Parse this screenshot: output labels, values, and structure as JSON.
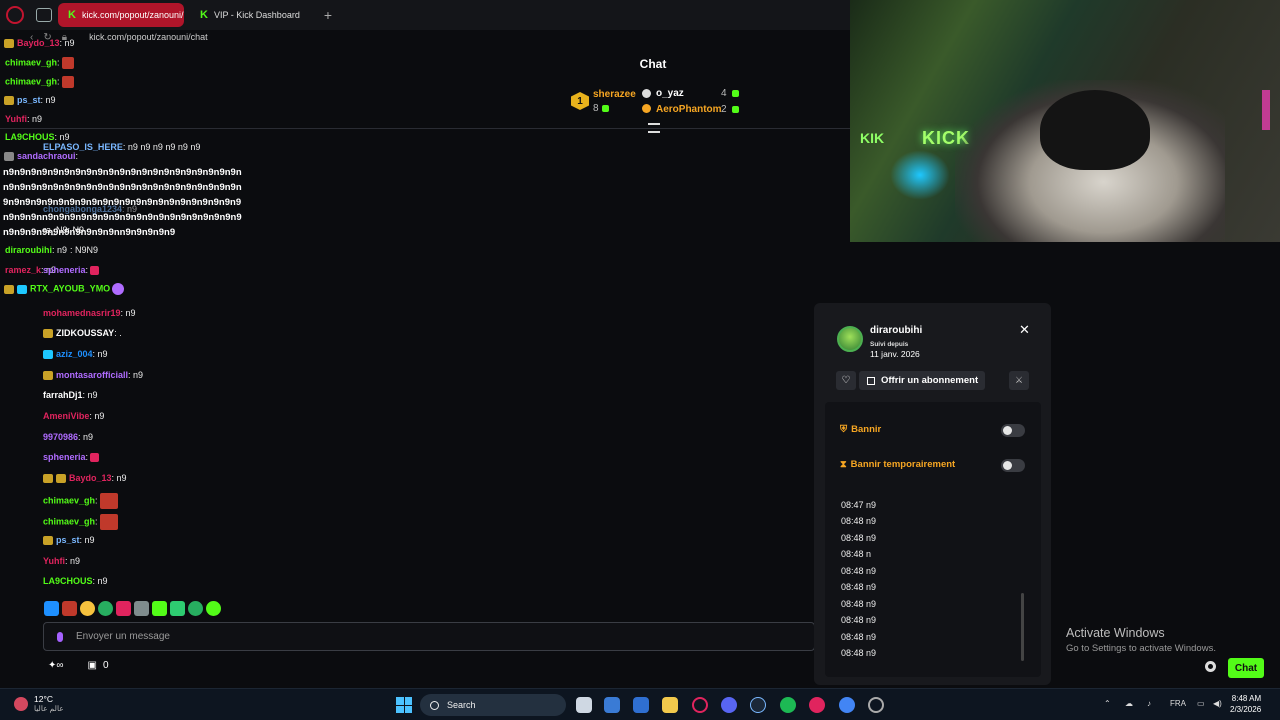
{
  "browser": {
    "tabs": [
      {
        "label": "kick.com/popout/zanouni/"
      },
      {
        "label": "VIP - Kick Dashboard"
      }
    ],
    "url": "kick.com/popout/zanouni/chat"
  },
  "chat": {
    "title": "Chat",
    "leaderboard": {
      "rank1": {
        "rank": "1",
        "name": "sherazee",
        "count": "8"
      },
      "others": [
        {
          "name": "o_yaz",
          "count": "4"
        },
        {
          "name": "AeroPhantom",
          "count": "2"
        }
      ]
    },
    "messages": [
      {
        "user": "Baydo_13",
        "text": ": n9"
      },
      {
        "user": "chimaev_gh",
        "text": ":"
      },
      {
        "user": "chimaev_gh",
        "text": ":"
      },
      {
        "user": "ps_st",
        "text": ": n9"
      },
      {
        "user": "Yuhfi",
        "text": ": n9"
      },
      {
        "user": "LA9CHOUS",
        "text": ": n9"
      },
      {
        "user": "ELPASO_IS_HERE",
        "text": ": n9 n9 n9 n9 n9 n9"
      },
      {
        "user": "sandachraoui",
        "text": ":"
      },
      {
        "user": "chongabonga1234",
        "text": ": n9"
      },
      {
        "user": "",
        "text": "ra_N9: N9"
      },
      {
        "user": "diraroubihi",
        "text": ": n9"
      },
      {
        "user": "",
        "text": ": N9N9"
      },
      {
        "user": "ramez_k",
        "text": ": n9"
      },
      {
        "user": "spheneria",
        "text": ":"
      },
      {
        "user": "RTX_AYOUB_YMO",
        "text": ""
      },
      {
        "user": "mohamednasrir19",
        "text": ": n9"
      },
      {
        "user": "ZIDKOUSSAY",
        "text": ": ."
      },
      {
        "user": "aziz_004",
        "text": ": n9"
      },
      {
        "user": "montasarofficiall",
        "text": ": n9"
      },
      {
        "user": "farrahDj1",
        "text": ": n9"
      },
      {
        "user": "AmeniVibe",
        "text": ": n9"
      },
      {
        "user": "9970986",
        "text": ": n9"
      },
      {
        "user": "spheneria",
        "text": ":"
      },
      {
        "user": "Baydo_13",
        "text": ": n9"
      },
      {
        "user": "chimaev_gh",
        "text": ":"
      },
      {
        "user": "chimaev_gh",
        "text": ":"
      },
      {
        "user": "ps_st",
        "text": ": n9"
      },
      {
        "user": "Yuhfi",
        "text": ": n9"
      },
      {
        "user": "LA9CHOUS",
        "text": ": n9"
      }
    ],
    "spam_text": "n9n9n9n9n9n9n9n9n9n9n9n9n9n9n9n9n9n9n9n9n9nn9n9n9n9n9n9n9n9n9n9n9n9n9n9n9n9n9n9n9n9n9n9n9n9n9n9n9n9n9n9n9n9n9n9n9n9n9n9n9n9n9n9n9n9n9n9nn9n9n9n9n9n9n9n9n9n9n9n9n9n9n9n9n9n9n9n9n9n9n9n9n9n9n9n9nn9n9n9n9n9",
    "input_placeholder": "Envoyer un message",
    "points": "0",
    "chat_button": "Chat"
  },
  "user_card": {
    "username": "diraroubihi",
    "followed_label": "Suivi depuis",
    "followed_date": "11 janv. 2026",
    "gift_label": "Offrir un abonnement",
    "ban_label": "Bannir",
    "timeout_label": "Bannir temporairement",
    "history": [
      "08:47 n9",
      "08:48 n9",
      "08:48 n9",
      "08:48 n",
      "08:48 n9",
      "08:48 n9",
      "08:48 n9",
      "08:48 n9",
      "08:48 n9",
      "08:48 n9"
    ]
  },
  "webcam": {
    "sign": "KICK",
    "sign_left": "KIK"
  },
  "windows_notice": {
    "title": "Activate Windows",
    "subtitle": "Go to Settings to activate Windows."
  },
  "taskbar": {
    "weather_temp": "12°C",
    "weather_loc": "عالم عاليا",
    "search_label": "Search",
    "language": "FRA",
    "time": "8:48 AM",
    "date": "2/3/2026"
  },
  "colors": {
    "kick_green": "#53fc18",
    "card_bg": "#18191d",
    "warn_orange": "#f6a623"
  }
}
